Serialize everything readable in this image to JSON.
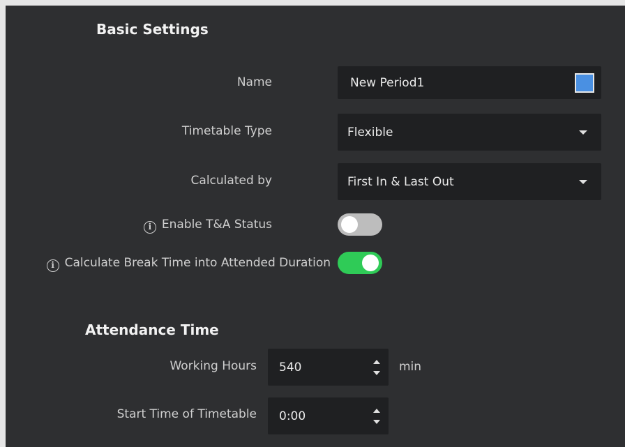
{
  "basic_settings": {
    "title": "Basic Settings",
    "name": {
      "label": "Name",
      "value": "New Period1",
      "color": "#4a90e2"
    },
    "timetable_type": {
      "label": "Timetable Type",
      "value": "Flexible"
    },
    "calculated_by": {
      "label": "Calculated by",
      "value": "First In & Last Out"
    },
    "enable_ta_status": {
      "label": "Enable T&A Status",
      "on": false
    },
    "calc_break_time": {
      "label": "Calculate Break Time into Attended Duration",
      "on": true
    }
  },
  "attendance_time": {
    "title": "Attendance Time",
    "working_hours": {
      "label": "Working Hours",
      "value": "540",
      "unit": "min"
    },
    "start_time": {
      "label": "Start Time of Timetable",
      "value": "0:00"
    }
  },
  "colors": {
    "background": "#2e2f31",
    "field": "#1f2022",
    "toggle_on": "#2fcb57",
    "toggle_off": "#bdbdbd"
  }
}
